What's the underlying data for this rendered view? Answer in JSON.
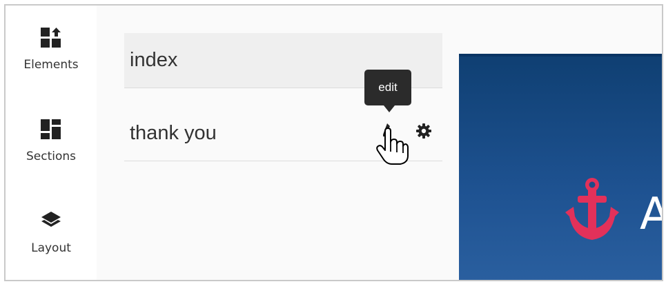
{
  "sidebar": {
    "items": [
      {
        "label": "Elements",
        "icon": "elements-add-icon"
      },
      {
        "label": "Sections",
        "icon": "sections-grid-icon"
      },
      {
        "label": "Layout",
        "icon": "layers-icon"
      }
    ]
  },
  "pages": {
    "items": [
      {
        "label": "index"
      },
      {
        "label": "thank you"
      }
    ],
    "tooltip": "edit"
  },
  "preview": {
    "brand_partial": "A",
    "accent_color": "#e2315a",
    "background_color": "#1a4c8a"
  }
}
